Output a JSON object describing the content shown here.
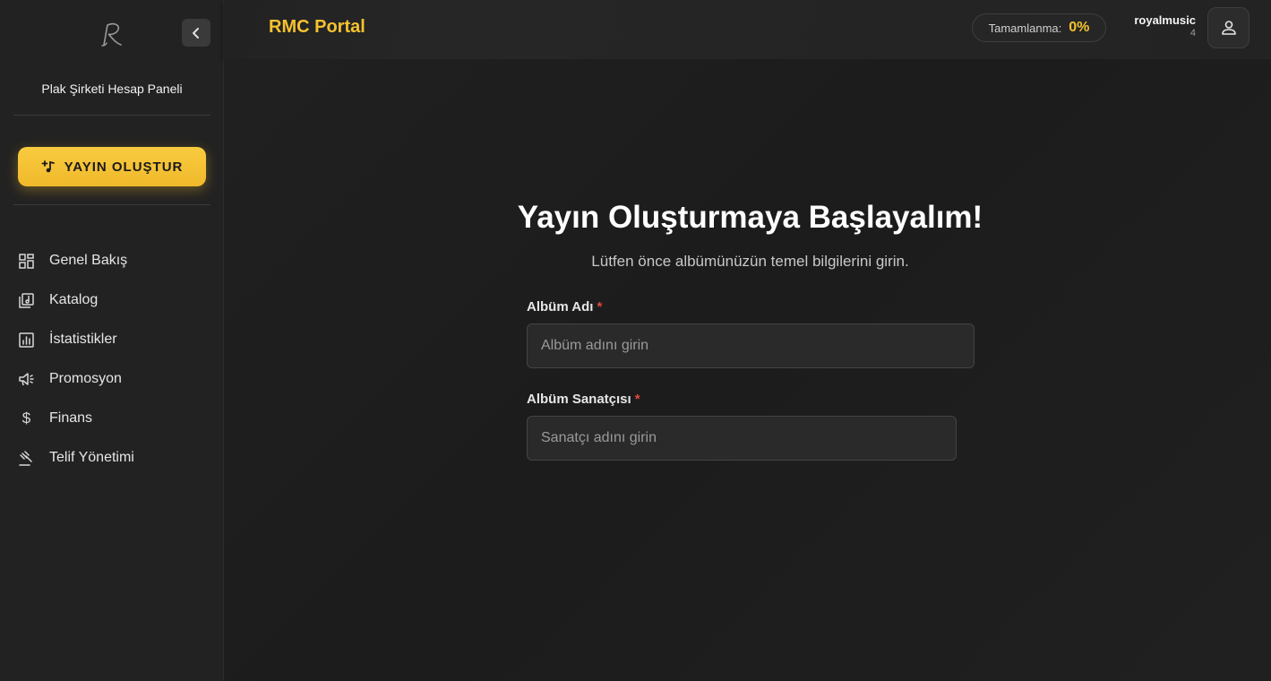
{
  "sidebar": {
    "panel_title": "Plak Şirketi Hesap Paneli",
    "cta_label": "YAYIN OLUŞTUR",
    "items": [
      {
        "label": "Genel Bakış",
        "icon": "grid-icon"
      },
      {
        "label": "Katalog",
        "icon": "music-library-icon"
      },
      {
        "label": "İstatistikler",
        "icon": "bar-chart-icon"
      },
      {
        "label": "Promosyon",
        "icon": "megaphone-icon"
      },
      {
        "label": "Finans",
        "icon": "dollar-icon"
      },
      {
        "label": "Telif Yönetimi",
        "icon": "gavel-icon"
      }
    ]
  },
  "header": {
    "brand": "RMC Portal",
    "progress_label": "Tamamlanma:",
    "progress_value": "0%",
    "username": "royalmusic",
    "user_count": "4"
  },
  "main": {
    "title": "Yayın Oluşturmaya Başlayalım!",
    "subtitle": "Lütfen önce albümünüzün temel bilgilerini girin.",
    "fields": [
      {
        "label": "Albüm Adı",
        "required_mark": "*",
        "placeholder": "Albüm adını girin",
        "value": ""
      },
      {
        "label": "Albüm Sanatçısı",
        "required_mark": "*",
        "placeholder": "Sanatçı adını girin",
        "value": ""
      }
    ]
  },
  "colors": {
    "accent": "#f5c22e",
    "background": "#1e1e1e",
    "sidebar": "#222222",
    "required": "#e0483c"
  }
}
